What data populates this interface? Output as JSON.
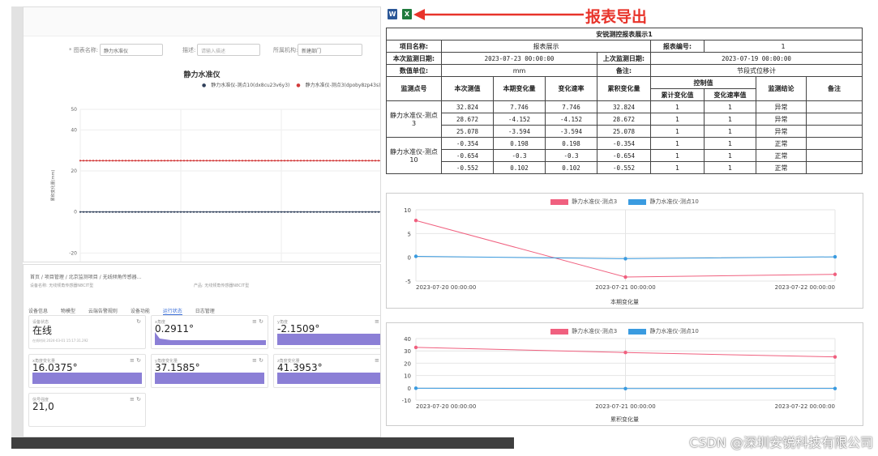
{
  "left_top": {
    "filter": {
      "chart_name_label": "* 图表名称:",
      "chart_name_value": "静力水准仪",
      "desc_label": "描述:",
      "desc_placeholder": "请输入描述",
      "org_label": "所属机构:",
      "org_value": "新建部门"
    },
    "chart": {
      "title": "静力水准仪",
      "legend": [
        "静力水准仪-测点10(dx8cu23v6y3)",
        "静力水准仪-测点3(dpoby8zp43s)"
      ],
      "ylabel": "累积变化量(mm)"
    },
    "chart_data": {
      "type": "line",
      "title": "静力水准仪",
      "ylabel": "累积变化量(mm)",
      "yticks": [
        "50",
        "40",
        "20",
        "0",
        "-20"
      ],
      "ylim": [
        -25,
        50
      ],
      "series": [
        {
          "name": "静力水准仪-测点10(dx8cu23v6y3)",
          "color": "#2f3f5a",
          "level": 0
        },
        {
          "name": "静力水准仪-测点3(dpoby8zp43s)",
          "color": "#d23a3a",
          "level": 25
        }
      ]
    }
  },
  "left_bottom": {
    "breadcrumb": [
      "首页",
      "项目管理",
      "北京监测项目",
      "无线倾角传感器..."
    ],
    "sub": "设备名称: 无线倾角传感器N8CIT型",
    "product": "产品: 无线倾角传感器N8CIT型",
    "tabs": [
      "设备信息",
      "物模型",
      "云端告警规则",
      "设备功能",
      "运行状态",
      "日志管理"
    ],
    "cards": [
      {
        "label": "设备状态",
        "value": "在线",
        "note": "在线时间 2024-03-01 15:17:31.292",
        "bar": false
      },
      {
        "label": "x角度",
        "value": "0.2911°",
        "bar": true,
        "fill": 0.2
      },
      {
        "label": "y角度",
        "value": "-2.1509°",
        "bar": true,
        "fill": 1
      },
      {
        "label": "x角度变化量",
        "value": "16.0375°",
        "bar": true,
        "fill": 1
      },
      {
        "label": "y角度变化量",
        "value": "37.1585°",
        "bar": true,
        "fill": 1
      },
      {
        "label": "z角度变化量",
        "value": "41.3953°",
        "bar": true,
        "fill": 1
      },
      {
        "label": "信号强度",
        "value": "21,0",
        "bar": false
      }
    ]
  },
  "report": {
    "export_label": "报表导出",
    "word_icon": "W",
    "excel_icon": "X",
    "table": {
      "title": "安锐测控报表展示1",
      "project_name_label": "项目名称:",
      "project_name": "报表展示",
      "report_no_label": "报表编号:",
      "report_no": "1",
      "this_date_label": "本次监测日期:",
      "this_date": "2023-07-23 00:00:00",
      "last_date_label": "上次监测日期:",
      "last_date": "2023-07-19 00:00:00",
      "unit_label": "数值单位:",
      "unit": "mm",
      "remark_label": "备注:",
      "remark": "节段式位移计",
      "col_point": "监测点号",
      "col_this": "本次测值",
      "col_period": "本期变化量",
      "col_rate": "变化速率",
      "col_accum": "累积变化量",
      "col_control": "控制值",
      "col_accum_ctrl": "累计变化值",
      "col_rate_ctrl": "变化速率值",
      "col_result": "监测结论",
      "col_note": "备注",
      "groups": [
        {
          "name": "静力水准仪-测点3",
          "rows": [
            [
              "32.824",
              "7.746",
              "7.746",
              "32.824",
              "1",
              "1",
              "异常",
              ""
            ],
            [
              "28.672",
              "-4.152",
              "-4.152",
              "28.672",
              "1",
              "1",
              "异常",
              ""
            ],
            [
              "25.078",
              "-3.594",
              "-3.594",
              "25.078",
              "1",
              "1",
              "异常",
              ""
            ]
          ]
        },
        {
          "name": "静力水准仪-测点10",
          "rows": [
            [
              "-0.354",
              "0.198",
              "0.198",
              "-0.354",
              "1",
              "1",
              "正常",
              ""
            ],
            [
              "-0.654",
              "-0.3",
              "-0.3",
              "-0.654",
              "1",
              "1",
              "正常",
              ""
            ],
            [
              "-0.552",
              "0.102",
              "0.102",
              "-0.552",
              "1",
              "1",
              "正常",
              ""
            ]
          ]
        }
      ]
    },
    "chart_data": [
      {
        "type": "line",
        "caption": "本期变化量",
        "categories": [
          "2023-07-20 00:00:00",
          "2023-07-21 00:00:00",
          "2023-07-22 00:00:00"
        ],
        "yticks": [
          "10",
          "5",
          "0",
          "-5"
        ],
        "ylim": [
          -5,
          10
        ],
        "series": [
          {
            "name": "静力水准仪-测点3",
            "color": "#f0607f",
            "values": [
              7.746,
              -4.152,
              -3.594
            ]
          },
          {
            "name": "静力水准仪-测点10",
            "color": "#3a9be0",
            "values": [
              0.198,
              -0.3,
              0.102
            ]
          }
        ]
      },
      {
        "type": "line",
        "caption": "累积变化量",
        "categories": [
          "2023-07-20 00:00:00",
          "2023-07-21 00:00:00",
          "2023-07-22 00:00:00"
        ],
        "yticks": [
          "40",
          "30",
          "20",
          "10",
          "0",
          "-10"
        ],
        "ylim": [
          -10,
          40
        ],
        "series": [
          {
            "name": "静力水准仪-测点3",
            "color": "#f0607f",
            "values": [
              32.824,
              28.672,
              25.078
            ]
          },
          {
            "name": "静力水准仪-测点10",
            "color": "#3a9be0",
            "values": [
              -0.354,
              -0.654,
              -0.552
            ]
          }
        ]
      }
    ]
  },
  "watermark": "CSDN @深圳安锐科技有限公司"
}
